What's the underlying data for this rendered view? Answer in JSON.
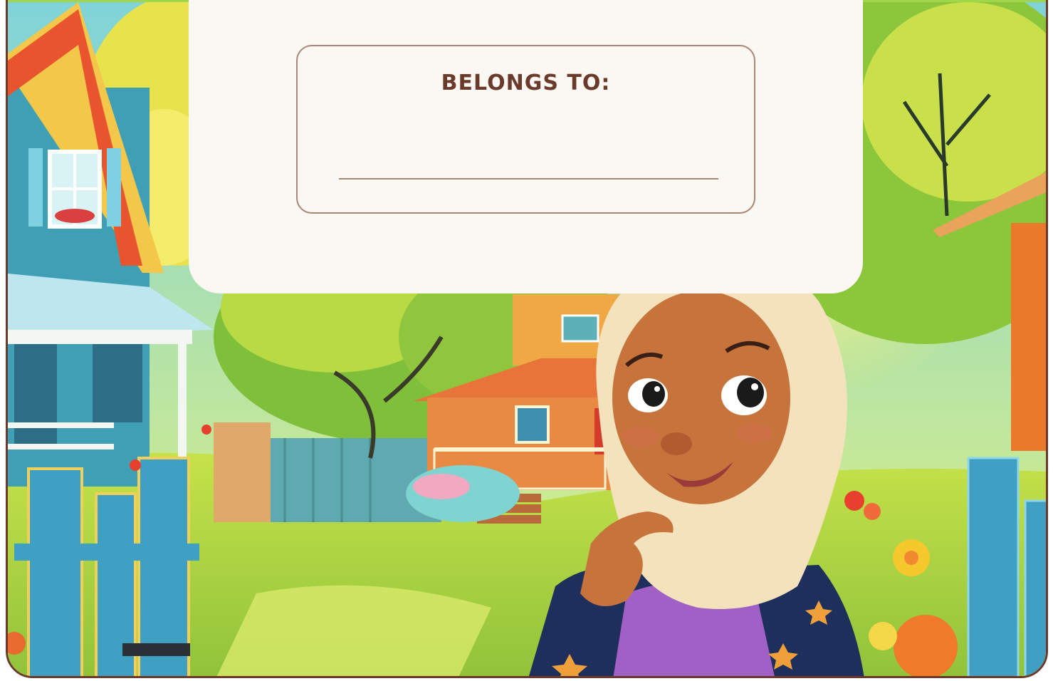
{
  "nameplate": {
    "label": "BELONGS TO:",
    "input_value": ""
  },
  "illustration": {
    "subject": "illustration",
    "colors": {
      "border": "#6b3a2c",
      "panel": "#fbf8f4",
      "label": "#6a3a2a",
      "box_outline": "#a98676"
    }
  }
}
